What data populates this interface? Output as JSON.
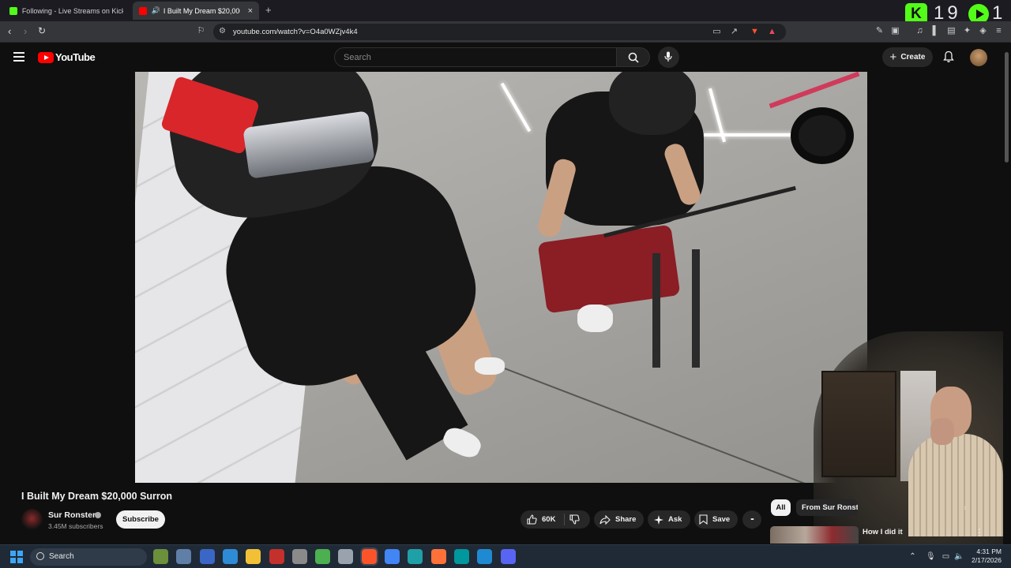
{
  "browser": {
    "tabs": [
      {
        "label": "Following - Live Streams on Kick",
        "favicon_color": "#53fc18",
        "active": false
      },
      {
        "label": "I Built My Dream $20,000 Surr",
        "favicon_color": "#ff0000",
        "active": true
      }
    ],
    "new_tab": "+",
    "url": "youtube.com/watch?v=O4a0WZjv4k4"
  },
  "overlay": {
    "kick_letter": "K",
    "kick_count": "19",
    "play_count": "1"
  },
  "youtube": {
    "logo_text": "YouTube",
    "search_placeholder": "Search",
    "create_label": "Create",
    "create_plus": "+",
    "video": {
      "title": "I Built My Dream $20,000 Surron",
      "channel": "Sur Ronster",
      "subscribers": "3.45M subscribers",
      "subscribe_label": "Subscribe",
      "likes": "60K",
      "share_label": "Share",
      "ask_label": "Ask",
      "save_label": "Save",
      "more": "•••"
    },
    "sidebar": {
      "chips": [
        "All",
        "From Sur Ronster"
      ],
      "chip_next": "›",
      "recommended": [
        {
          "title": "How I did it",
          "more": "⋮"
        }
      ]
    }
  },
  "taskbar": {
    "search_label": "Search",
    "time": "4:31 PM",
    "date": "2/17/2026",
    "apps": [
      {
        "name": "frogger-widget",
        "color": "#6b8f3a"
      },
      {
        "name": "tools-app",
        "color": "#5f7ea8"
      },
      {
        "name": "store-app",
        "color": "#3a66c5"
      },
      {
        "name": "remote-app",
        "color": "#2e8bd6"
      },
      {
        "name": "file-explorer",
        "color": "#f2c037"
      },
      {
        "name": "news-app",
        "color": "#c4302b"
      },
      {
        "name": "clock-app",
        "color": "#8a8a8a"
      },
      {
        "name": "shield-app",
        "color": "#4caf50"
      },
      {
        "name": "timer-app",
        "color": "#9aa3ad"
      },
      {
        "name": "brave-browser",
        "color": "#fb542b"
      },
      {
        "name": "chrome-browser",
        "color": "#4285f4"
      },
      {
        "name": "edge-browser",
        "color": "#1fa0a6"
      },
      {
        "name": "firefox-browser",
        "color": "#ff7139"
      },
      {
        "name": "arduino-app",
        "color": "#00979d"
      },
      {
        "name": "vscode-app",
        "color": "#1f8ad2"
      },
      {
        "name": "discord-app",
        "color": "#5865f2"
      }
    ]
  },
  "colors": {
    "youtube_red": "#ff0000",
    "kick_green": "#53fc18",
    "background": "#0f0f0f"
  }
}
